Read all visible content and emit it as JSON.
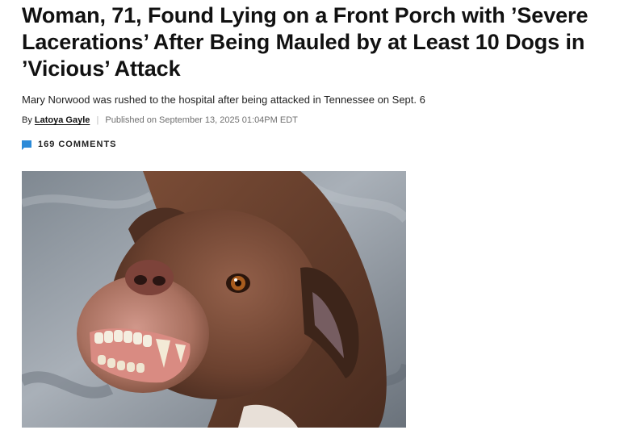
{
  "article": {
    "headline": "Woman, 71, Found Lying on a Front Porch with ’Severe Lacerations’ After Being Mauled by at Least 10 Dogs in ’Vicious’ Attack",
    "subheading": "Mary Norwood was rushed to the hospital after being attacked in Tennessee on Sept. 6",
    "byline": {
      "prefix": "By",
      "author": "Latoya Gayle",
      "separator": "|",
      "published": "Published on September 13, 2025 01:04PM EDT"
    },
    "comments": {
      "icon": "comment-bubble-icon",
      "count": "169",
      "label": "COMMENTS"
    }
  },
  "colors": {
    "text": "#111111",
    "muted": "#6f6f6f",
    "accent": "#2b8ad8"
  }
}
